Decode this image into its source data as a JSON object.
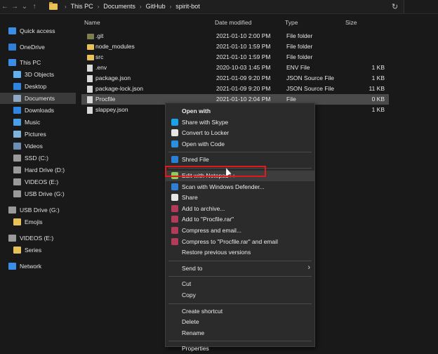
{
  "address_bar": {
    "crumbs": [
      "This PC",
      "Documents",
      "GitHub",
      "spirit-bot"
    ]
  },
  "sidebar": {
    "items": [
      {
        "label": "Quick access",
        "icon": "star-icon",
        "color": "#3b8ee8"
      },
      {
        "label": "OneDrive",
        "icon": "cloud-icon",
        "color": "#2f7fd6"
      },
      {
        "label": "This PC",
        "icon": "computer-icon",
        "color": "#3b8ee8"
      },
      {
        "label": "3D Objects",
        "icon": "cube-icon",
        "color": "#62b0ee"
      },
      {
        "label": "Desktop",
        "icon": "desktop-icon",
        "color": "#2f86e0"
      },
      {
        "label": "Documents",
        "icon": "document-icon",
        "color": "#8fa8c4"
      },
      {
        "label": "Downloads",
        "icon": "download-icon",
        "color": "#2f86e0"
      },
      {
        "label": "Music",
        "icon": "music-icon",
        "color": "#4aa0e8"
      },
      {
        "label": "Pictures",
        "icon": "picture-icon",
        "color": "#7fb3d9"
      },
      {
        "label": "Videos",
        "icon": "video-icon",
        "color": "#6c8fb5"
      },
      {
        "label": "SSD (C:)",
        "icon": "drive-icon",
        "color": "#9a9a9a"
      },
      {
        "label": "Hard Drive (D:)",
        "icon": "drive-icon",
        "color": "#9a9a9a"
      },
      {
        "label": "VIDEOS (E:)",
        "icon": "drive-icon",
        "color": "#9a9a9a"
      },
      {
        "label": "USB Drive (G:)",
        "icon": "usb-drive-icon",
        "color": "#9a9a9a"
      },
      {
        "label": "USB Drive (G:)",
        "icon": "usb-drive-icon",
        "color": "#9a9a9a"
      },
      {
        "label": "Emojis",
        "icon": "folder-icon",
        "color": "#e8c157"
      },
      {
        "label": "VIDEOS (E:)",
        "icon": "drive-icon",
        "color": "#9a9a9a"
      },
      {
        "label": "Series",
        "icon": "folder-icon",
        "color": "#e8c157"
      },
      {
        "label": "Network",
        "icon": "network-icon",
        "color": "#3b8ee8"
      }
    ]
  },
  "columns": {
    "name": "Name",
    "date": "Date modified",
    "type": "Type",
    "size": "Size"
  },
  "files": [
    {
      "name": ".git",
      "date": "2021-01-10 2:00 PM",
      "type": "File folder",
      "size": "",
      "kind": "folder-dim"
    },
    {
      "name": "node_modules",
      "date": "2021-01-10 1:59 PM",
      "type": "File folder",
      "size": "",
      "kind": "folder"
    },
    {
      "name": "src",
      "date": "2021-01-10 1:59 PM",
      "type": "File folder",
      "size": "",
      "kind": "folder"
    },
    {
      "name": ".env",
      "date": "2020-10-03 1:45 PM",
      "type": "ENV File",
      "size": "1 KB",
      "kind": "file"
    },
    {
      "name": "package.json",
      "date": "2021-01-09 9:20 PM",
      "type": "JSON Source File",
      "size": "1 KB",
      "kind": "file"
    },
    {
      "name": "package-lock.json",
      "date": "2021-01-09 9:20 PM",
      "type": "JSON Source File",
      "size": "11 KB",
      "kind": "file"
    },
    {
      "name": "Procfile",
      "date": "2021-01-10 2:04 PM",
      "type": "File",
      "size": "0 KB",
      "kind": "file"
    },
    {
      "name": "slappey.json",
      "date": "",
      "type": "ce File",
      "size": "1 KB",
      "kind": "file"
    }
  ],
  "context_menu": {
    "items": [
      {
        "label": "Open with",
        "icon": "",
        "bold": true
      },
      {
        "label": "Share with Skype",
        "icon": "skype-icon",
        "color": "#1aa3e8"
      },
      {
        "label": "Convert to Locker",
        "icon": "locker-icon",
        "color": "#e6e6e6"
      },
      {
        "label": "Open with Code",
        "icon": "vscode-icon",
        "color": "#2a8fe0"
      },
      {
        "sep": true
      },
      {
        "label": "Shred File",
        "icon": "shred-icon",
        "color": "#2a7fd6"
      },
      {
        "sep": true
      },
      {
        "label": "Edit with Notepad++",
        "icon": "notepadpp-icon",
        "color": "#8ccf5a"
      },
      {
        "label": "Scan with Windows Defender...",
        "icon": "defender-icon",
        "color": "#2f7fd6"
      },
      {
        "label": "Share",
        "icon": "share-icon",
        "color": "#e6e6e6"
      },
      {
        "label": "Add to archive...",
        "icon": "winrar-icon",
        "color": "#b23a5a"
      },
      {
        "label": "Add to \"Procfile.rar\"",
        "icon": "winrar-icon",
        "color": "#b23a5a"
      },
      {
        "label": "Compress and email...",
        "icon": "winrar-icon",
        "color": "#b23a5a"
      },
      {
        "label": "Compress to \"Procfile.rar\" and email",
        "icon": "winrar-icon",
        "color": "#b23a5a"
      },
      {
        "label": "Restore previous versions",
        "icon": "",
        "color": ""
      },
      {
        "sep": true
      },
      {
        "label": "Send to",
        "icon": "",
        "submenu": true
      },
      {
        "sep": true
      },
      {
        "label": "Cut",
        "icon": ""
      },
      {
        "label": "Copy",
        "icon": ""
      },
      {
        "sep": true
      },
      {
        "label": "Create shortcut",
        "icon": ""
      },
      {
        "label": "Delete",
        "icon": ""
      },
      {
        "label": "Rename",
        "icon": ""
      },
      {
        "sep": true
      },
      {
        "label": "Properties",
        "icon": ""
      }
    ]
  },
  "highlight_color": "#e0191f"
}
